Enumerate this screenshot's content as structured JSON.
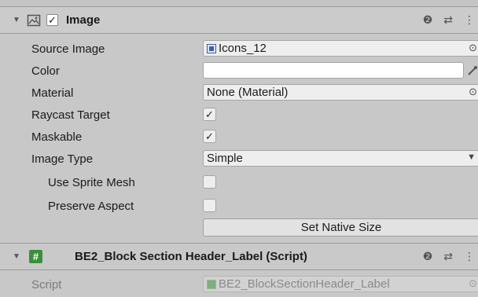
{
  "image_component": {
    "title": "Image",
    "enabled_check": "✓",
    "help_icon": "help-icon",
    "settings_icon": "sliders-icon",
    "menu_icon": "kebab-icon"
  },
  "fields": {
    "source_image": {
      "label": "Source Image",
      "value": "Icons_12"
    },
    "color": {
      "label": "Color",
      "value": ""
    },
    "material": {
      "label": "Material",
      "value": "None (Material)"
    },
    "raycast_target": {
      "label": "Raycast Target",
      "check": "✓"
    },
    "maskable": {
      "label": "Maskable",
      "check": "✓"
    },
    "image_type": {
      "label": "Image Type",
      "value": "Simple"
    },
    "use_sprite_mesh": {
      "label": "Use Sprite Mesh",
      "check": ""
    },
    "preserve_aspect": {
      "label": "Preserve Aspect",
      "check": ""
    }
  },
  "buttons": {
    "set_native_size": "Set Native Size"
  },
  "script_component": {
    "title": "BE2_Block Section Header_Label (Script)",
    "hash_glyph": "#",
    "script_label": "Script",
    "script_value": "BE2_BlockSectionHeader_Label"
  },
  "glyphs": {
    "foldout": "▼",
    "object_picker": "⊙",
    "eyedropper": "🖊",
    "dropdown_arrow": "▼",
    "help": "❷",
    "sliders": "⇄",
    "kebab": "⋮"
  }
}
